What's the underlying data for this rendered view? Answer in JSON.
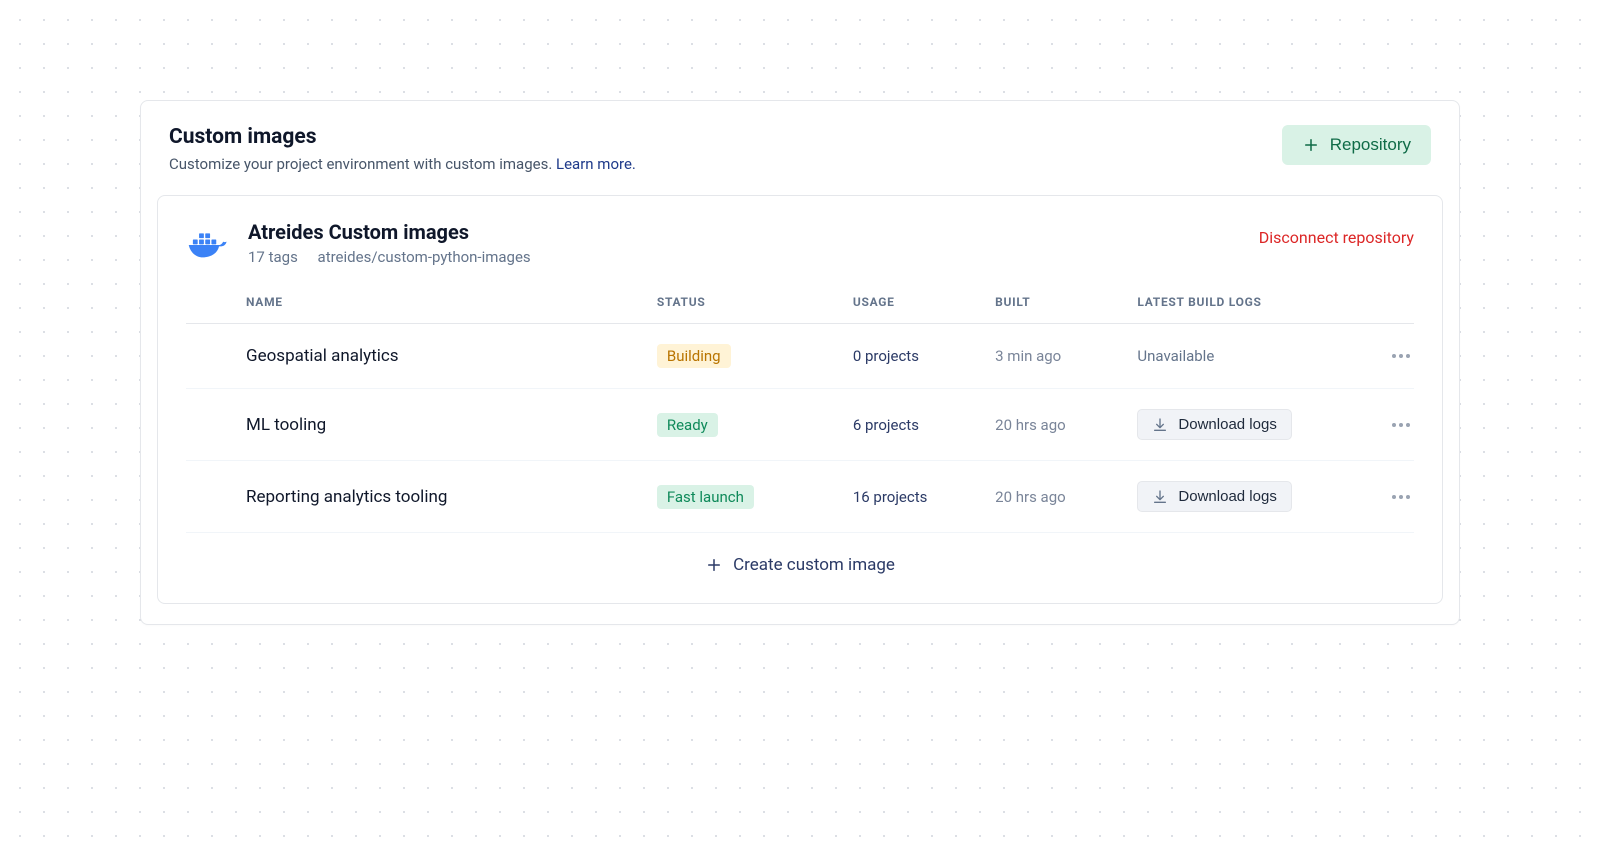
{
  "header": {
    "title": "Custom images",
    "subtitle_prefix": "Customize your project environment with custom images. ",
    "learn_more_label": "Learn more.",
    "repository_button_label": "Repository"
  },
  "card": {
    "title": "Atreides Custom images",
    "meta_tags": "17 tags",
    "meta_path": "atreides/custom-python-images",
    "disconnect_label": "Disconnect repository"
  },
  "table": {
    "columns": {
      "name": "NAME",
      "status": "STATUS",
      "usage": "USAGE",
      "built": "BUILT",
      "logs": "LATEST BUILD LOGS"
    },
    "rows": [
      {
        "name": "Geospatial analytics",
        "status_label": "Building",
        "status_kind": "building",
        "usage": "0 projects",
        "built": "3 min ago",
        "logs_kind": "unavailable",
        "logs_label": "Unavailable"
      },
      {
        "name": "ML tooling",
        "status_label": "Ready",
        "status_kind": "ready",
        "usage": "6 projects",
        "built": "20 hrs ago",
        "logs_kind": "download",
        "logs_label": "Download logs"
      },
      {
        "name": "Reporting analytics tooling",
        "status_label": "Fast launch",
        "status_kind": "fast",
        "usage": "16 projects",
        "built": "20 hrs ago",
        "logs_kind": "download",
        "logs_label": "Download logs"
      }
    ],
    "create_label": "Create custom image"
  }
}
